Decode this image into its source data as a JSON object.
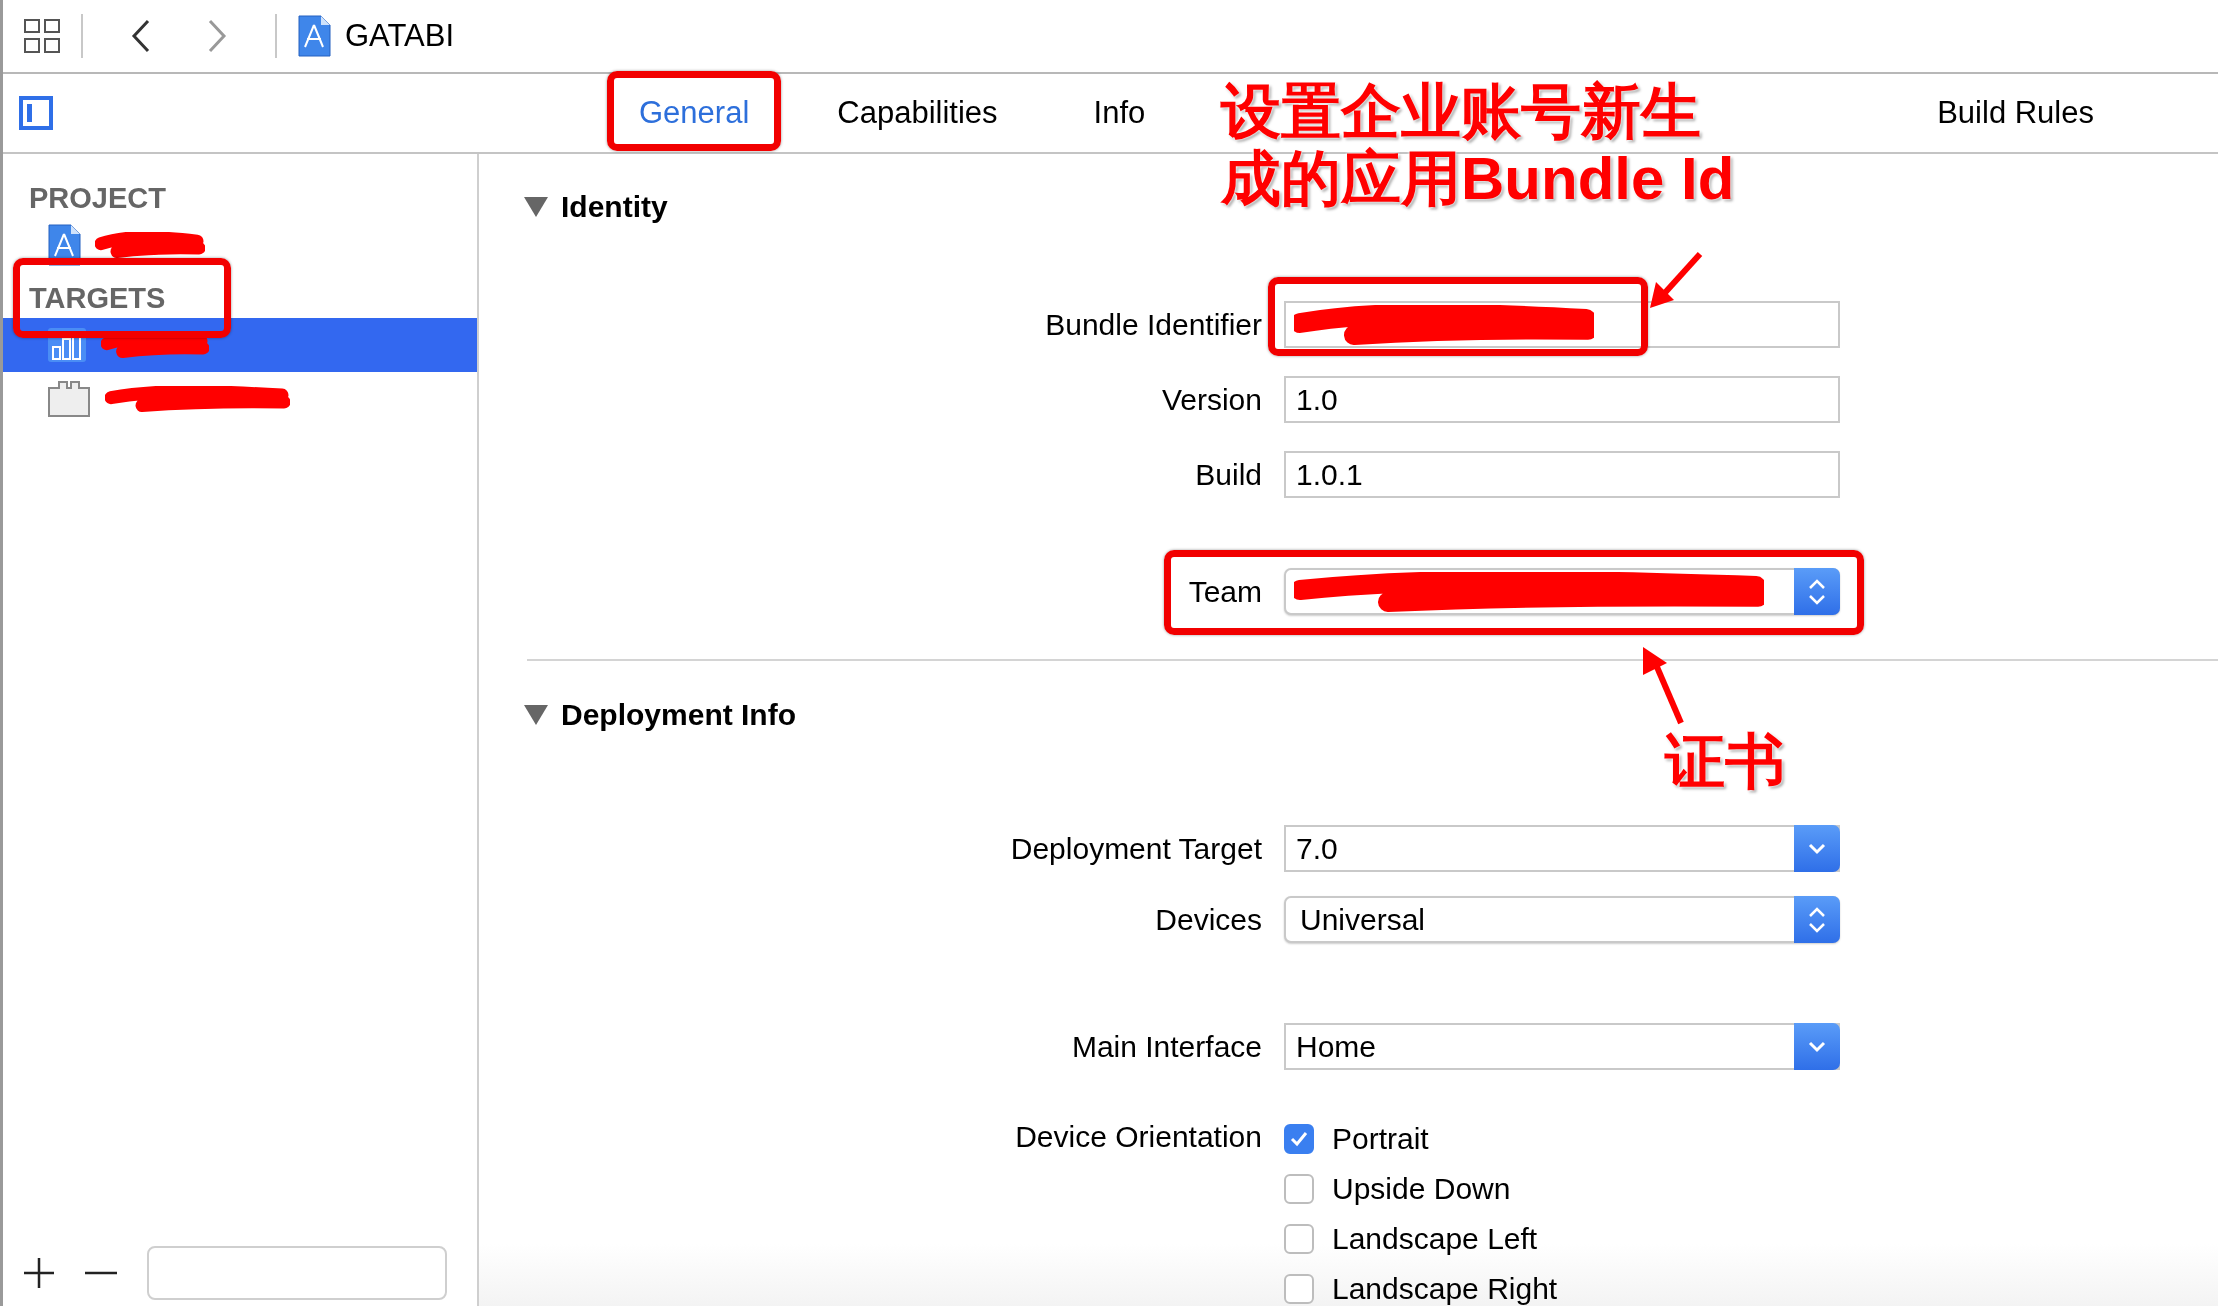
{
  "toolbar": {
    "title": "GATABI"
  },
  "tabs": [
    {
      "label": "General",
      "selected": true,
      "highlighted": true
    },
    {
      "label": "Capabilities",
      "selected": false
    },
    {
      "label": "Info",
      "selected": false
    },
    {
      "label": "Build Rules",
      "selected": false
    }
  ],
  "sidebar": {
    "sections": [
      {
        "title": "PROJECT",
        "items": [
          {
            "kind": "project",
            "selected": false
          }
        ]
      },
      {
        "title": "TARGETS",
        "highlighted": true,
        "items": [
          {
            "kind": "app",
            "selected": true
          },
          {
            "kind": "tests",
            "selected": false
          }
        ]
      }
    ]
  },
  "identity": {
    "title": "Identity",
    "expanded": true,
    "fields": [
      {
        "label": "Bundle Identifier",
        "kind": "text",
        "redacted": true,
        "highlighted": true
      },
      {
        "label": "Version",
        "kind": "text",
        "value": "1.0"
      },
      {
        "label": "Build",
        "kind": "text",
        "value": "1.0.1"
      },
      {
        "label": "Team",
        "kind": "popup",
        "redacted": true,
        "highlighted": true
      }
    ]
  },
  "deployment": {
    "title": "Deployment Info",
    "expanded": true,
    "fields": [
      {
        "label": "Deployment Target",
        "kind": "combo",
        "value": "7.0"
      },
      {
        "label": "Devices",
        "kind": "popup",
        "value": "Universal"
      },
      {
        "label": "Main Interface",
        "kind": "combo",
        "value": "Home"
      }
    ],
    "orientation": {
      "label": "Device Orientation",
      "options": [
        {
          "label": "Portrait",
          "checked": true
        },
        {
          "label": "Upside Down",
          "checked": false
        },
        {
          "label": "Landscape Left",
          "checked": false
        },
        {
          "label": "Landscape Right",
          "checked": false
        }
      ]
    }
  },
  "annotations": [
    {
      "kind": "note",
      "lines": [
        "设置企业账号新生",
        "成的应用Bundle Id"
      ]
    },
    {
      "kind": "note",
      "lines": [
        "证书"
      ]
    }
  ]
}
